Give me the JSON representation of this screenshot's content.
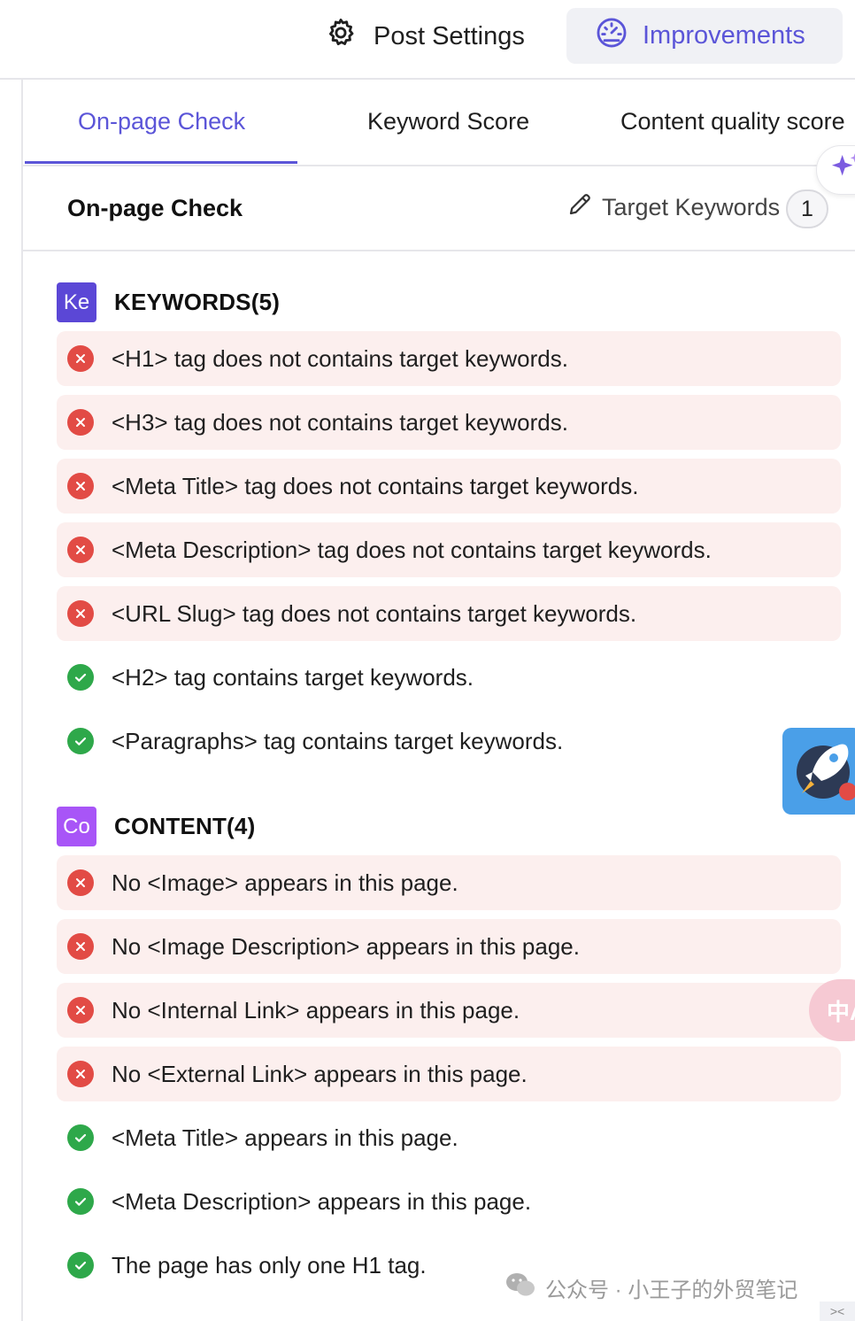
{
  "topbar": {
    "post_settings_label": "Post Settings",
    "improvements_label": "Improvements",
    "accent_color": "#5b55d8"
  },
  "tabs": [
    {
      "label": "On-page Check",
      "active": true
    },
    {
      "label": "Keyword Score",
      "active": false
    },
    {
      "label": "Content quality score",
      "active": false
    }
  ],
  "subheader": {
    "title": "On-page Check",
    "target_keywords_label": "Target Keywords",
    "target_keywords_count": "1"
  },
  "sections": {
    "keywords": {
      "badge": "Ke",
      "badge_color": "#5b47d6",
      "title": "KEYWORDS(5)",
      "items": [
        {
          "status": "fail",
          "text": "<H1> tag does not contains target keywords."
        },
        {
          "status": "fail",
          "text": "<H3> tag does not contains target keywords."
        },
        {
          "status": "fail",
          "text": "<Meta Title> tag does not contains target keywords."
        },
        {
          "status": "fail",
          "text": "<Meta Description> tag does not contains target keywords."
        },
        {
          "status": "fail",
          "text": "<URL Slug> tag does not contains target keywords."
        },
        {
          "status": "pass",
          "text": "<H2> tag contains target keywords."
        },
        {
          "status": "pass",
          "text": "<Paragraphs> tag contains target keywords."
        }
      ]
    },
    "content": {
      "badge": "Co",
      "badge_color": "#a855f7",
      "title": "CONTENT(4)",
      "items": [
        {
          "status": "fail",
          "text": "No <Image> appears in this page."
        },
        {
          "status": "fail",
          "text": "No <Image Description> appears in this page."
        },
        {
          "status": "fail",
          "text": "No <Internal Link> appears in this page."
        },
        {
          "status": "fail",
          "text": "No <External Link> appears in this page."
        },
        {
          "status": "pass",
          "text": "<Meta Title> appears in this page."
        },
        {
          "status": "pass",
          "text": "<Meta Description> appears in this page."
        },
        {
          "status": "pass",
          "text": "The page has only one H1 tag."
        }
      ]
    }
  },
  "widgets": {
    "translate_label": "中A",
    "watermark_text": "公众号 · 小王子的外贸笔记",
    "corner_label": "><"
  },
  "icons": [
    "gear-icon",
    "gauge-icon",
    "pencil-icon",
    "sparkle-icon",
    "x-icon",
    "check-icon",
    "rocket-icon",
    "wechat-icon"
  ]
}
